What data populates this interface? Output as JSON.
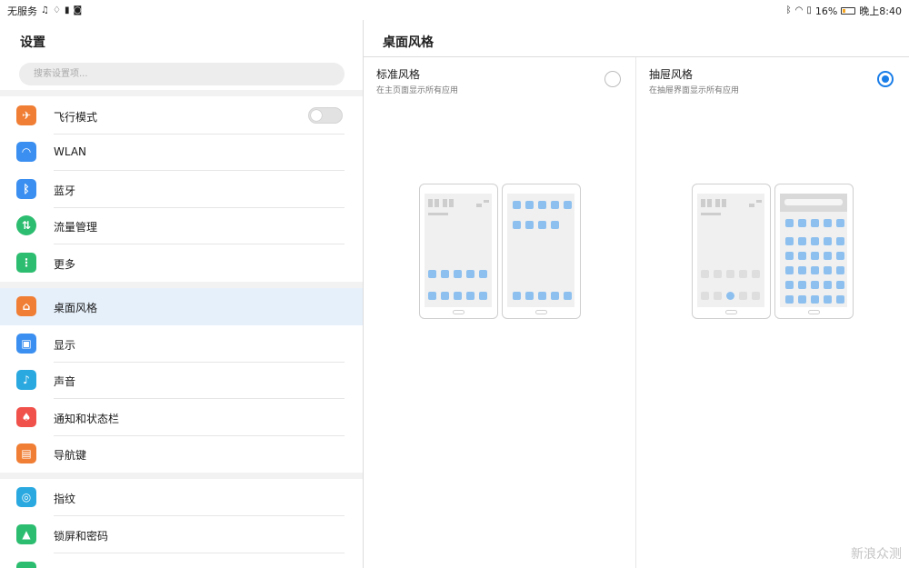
{
  "status_bar": {
    "left_text": "无服务",
    "battery": "16%",
    "time": "晚上8:40"
  },
  "left": {
    "title": "设置",
    "search_placeholder": "搜索设置项...",
    "items": [
      {
        "label": "飞行模式",
        "icon": "airplane-icon",
        "color": "#f07e34"
      },
      {
        "label": "WLAN",
        "icon": "wifi-icon",
        "color": "#3b8ff0"
      },
      {
        "label": "蓝牙",
        "icon": "bluetooth-icon",
        "color": "#3b8ff0"
      },
      {
        "label": "流量管理",
        "icon": "data-usage-icon",
        "color": "#2dbd70"
      },
      {
        "label": "更多",
        "icon": "more-icon",
        "color": "#2dbd70"
      },
      {
        "label": "桌面风格",
        "icon": "home-icon",
        "color": "#f07e34"
      },
      {
        "label": "显示",
        "icon": "display-icon",
        "color": "#3b8ff0"
      },
      {
        "label": "声音",
        "icon": "sound-icon",
        "color": "#2aa9e0"
      },
      {
        "label": "通知和状态栏",
        "icon": "bell-icon",
        "color": "#f0514a"
      },
      {
        "label": "导航键",
        "icon": "navigation-keys-icon",
        "color": "#f07e34"
      },
      {
        "label": "指纹",
        "icon": "fingerprint-icon",
        "color": "#2aa9e0"
      },
      {
        "label": "锁屏和密码",
        "icon": "lock-icon",
        "color": "#2dbd70"
      }
    ]
  },
  "right": {
    "title": "桌面风格",
    "options": [
      {
        "title": "标准风格",
        "subtitle": "在主页面显示所有应用",
        "selected": false
      },
      {
        "title": "抽屉风格",
        "subtitle": "在抽屉界面显示所有应用",
        "selected": true
      }
    ]
  },
  "watermark": "新浪众测",
  "colors": {
    "accent": "#1a7ee8",
    "active_row": "#e6f0fb"
  }
}
